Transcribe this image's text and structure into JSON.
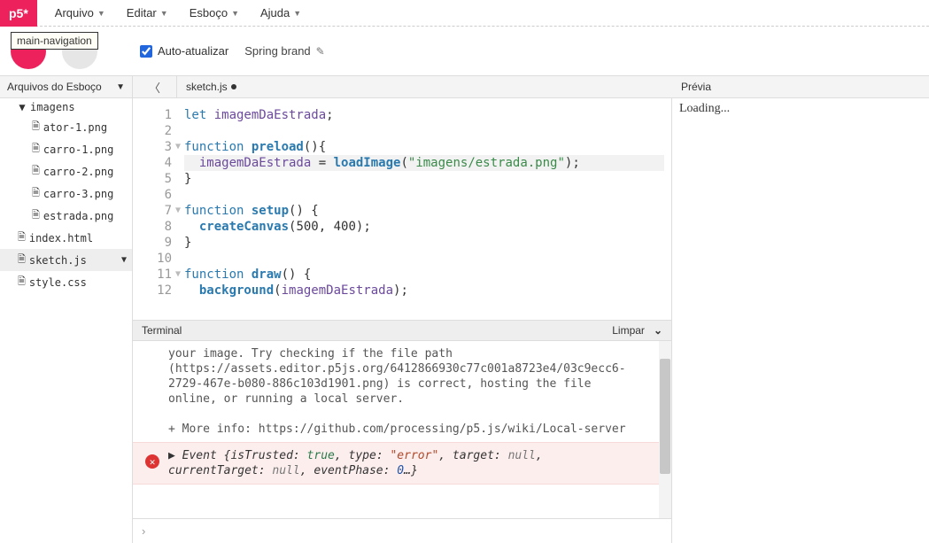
{
  "logo": "p5*",
  "menu": [
    "Arquivo",
    "Editar",
    "Esboço",
    "Ajuda"
  ],
  "tooltip": "main-navigation",
  "toolbar": {
    "auto_label": "Auto-atualizar",
    "auto_checked": true,
    "sketch_name": "Spring brand"
  },
  "sidebar": {
    "header": "Arquivos do Esboço",
    "tree": {
      "folder": "imagens",
      "images": [
        "ator-1.png",
        "carro-1.png",
        "carro-2.png",
        "carro-3.png",
        "estrada.png"
      ],
      "root_files": [
        "index.html",
        "sketch.js",
        "style.css"
      ],
      "selected": "sketch.js"
    }
  },
  "tab": {
    "filename": "sketch.js",
    "dirty": true
  },
  "code": {
    "lines": [
      {
        "n": 1,
        "seg": [
          [
            "kw",
            "let "
          ],
          [
            "id",
            "imagemDaEstrada"
          ],
          [
            "",
            ";"
          ]
        ]
      },
      {
        "n": 2,
        "seg": []
      },
      {
        "n": 3,
        "fold": true,
        "seg": [
          [
            "kw",
            "function "
          ],
          [
            "fn",
            "preload"
          ],
          [
            "",
            "(){"
          ]
        ]
      },
      {
        "n": 4,
        "hl": true,
        "seg": [
          [
            "",
            "  "
          ],
          [
            "id",
            "imagemDaEstrada"
          ],
          [
            "",
            " = "
          ],
          [
            "call",
            "loadImage"
          ],
          [
            "",
            "("
          ],
          [
            "str",
            "\"imagens/estrada.png\""
          ],
          [
            "",
            ");"
          ]
        ]
      },
      {
        "n": 5,
        "seg": [
          [
            "",
            "}"
          ]
        ]
      },
      {
        "n": 6,
        "seg": []
      },
      {
        "n": 7,
        "fold": true,
        "seg": [
          [
            "kw",
            "function "
          ],
          [
            "fn",
            "setup"
          ],
          [
            "",
            "() {"
          ]
        ]
      },
      {
        "n": 8,
        "seg": [
          [
            "",
            "  "
          ],
          [
            "call",
            "createCanvas"
          ],
          [
            "",
            "("
          ],
          [
            "num",
            "500"
          ],
          [
            "",
            ", "
          ],
          [
            "num",
            "400"
          ],
          [
            "",
            ");"
          ]
        ]
      },
      {
        "n": 9,
        "seg": [
          [
            "",
            "}"
          ]
        ]
      },
      {
        "n": 10,
        "seg": []
      },
      {
        "n": 11,
        "fold": true,
        "seg": [
          [
            "kw",
            "function "
          ],
          [
            "fn",
            "draw"
          ],
          [
            "",
            "() {"
          ]
        ]
      },
      {
        "n": 12,
        "seg": [
          [
            "",
            "  "
          ],
          [
            "call",
            "background"
          ],
          [
            "",
            "("
          ],
          [
            "id",
            "imagemDaEstrada"
          ],
          [
            "",
            ");"
          ]
        ]
      }
    ]
  },
  "terminal": {
    "title": "Terminal",
    "clear": "Limpar",
    "msg1": "your image. Try checking if the file path (https://assets.editor.p5js.org/6412866930c77c001a8723e4/03c9ecc6-2729-467e-b080-886c103d1901.png) is correct, hosting the file online, or running a local server.\n\n+ More info: https://github.com/processing/p5.js/wiki/Local-server",
    "event_prefix": "Event ",
    "event_obj": "{isTrusted: true, type: \"error\", target: null, currentTarget: null, eventPhase: 0…}"
  },
  "preview": {
    "title": "Prévia",
    "body": "Loading..."
  }
}
